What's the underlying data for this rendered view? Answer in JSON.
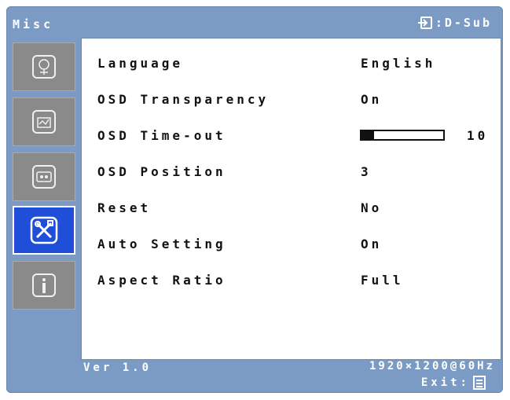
{
  "header": {
    "title": "Misc",
    "source": ":D-Sub"
  },
  "sidebar": {
    "items": [
      {
        "icon": "picture-icon",
        "active": false
      },
      {
        "icon": "color-icon",
        "active": false
      },
      {
        "icon": "image-settings-icon",
        "active": false
      },
      {
        "icon": "tools-icon",
        "active": true
      },
      {
        "icon": "info-icon",
        "active": false
      }
    ]
  },
  "menu": {
    "language": {
      "label": "Language",
      "value": "English"
    },
    "osd_transparency": {
      "label": "OSD Transparency",
      "value": "On"
    },
    "osd_timeout": {
      "label": "OSD Time-out",
      "value": "10",
      "fill_fraction": 0.15
    },
    "osd_position": {
      "label": "OSD Position",
      "value": "3"
    },
    "reset": {
      "label": "Reset",
      "value": "No"
    },
    "auto_setting": {
      "label": "Auto Setting",
      "value": "On"
    },
    "aspect_ratio": {
      "label": "Aspect Ratio",
      "value": "Full"
    }
  },
  "footer": {
    "version": "Ver 1.0",
    "resolution": "1920×1200@60Hz",
    "exit_label": "Exit:"
  },
  "colors": {
    "frame": "#7b9bc4",
    "panel": "#ffffff",
    "active_tab": "#1f4fd8",
    "inactive_tab": "#8a8a8a",
    "text": "#111111"
  }
}
